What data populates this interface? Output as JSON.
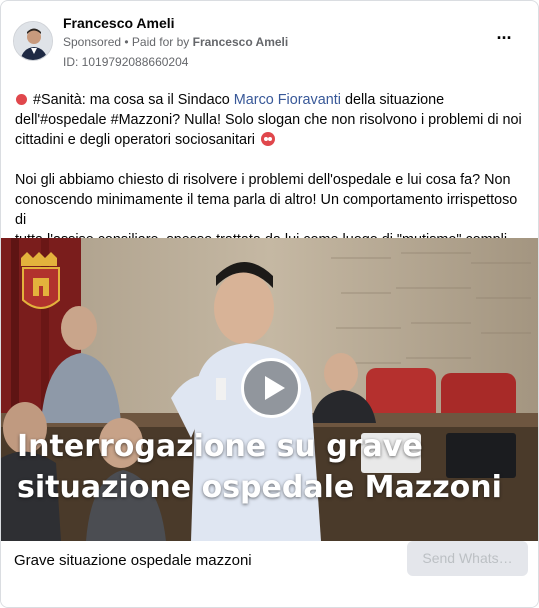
{
  "ad": {
    "advertiser_name": "Francesco Ameli",
    "sponsored_label": "Sponsored",
    "separator": " • ",
    "paid_for_label": "Paid for by ",
    "paid_for_name": "Francesco Ameli",
    "id_text": "ID: 1019792088660204",
    "more_icon": "more-options-icon"
  },
  "post": {
    "p1_part1": "#Sanità: ma cosa sa il Sindaco ",
    "p1_link": "Marco Fioravanti",
    "p1_part2": " della situazione dell'#ospedale #Mazzoni? Nulla! Solo slogan che non risolvono i problemi di noi cittadini e degli operatori sociosanitari",
    "p2_line1": "Noi gli abbiamo chiesto di risolvere i problemi dell'ospedale e lui cosa fa? Non conoscendo minimamente il tema parla di altro! Un comportamento irrispettoso di",
    "p2_line2": "tutta l'assise consiliare, spesso trattata da lui come luogo di \"mutismo\" complici i...",
    "colors": {
      "link": "#385898",
      "emoji_red": "#e0474c"
    }
  },
  "media": {
    "overlay_title": "Interrogazione su grave situazione ospedale Mazzoni",
    "play_icon": "play-icon",
    "crest_icon": "city-crest-icon"
  },
  "footer": {
    "headline": "Grave situazione ospedale mazzoni",
    "cta_label": "Send Whats…"
  }
}
